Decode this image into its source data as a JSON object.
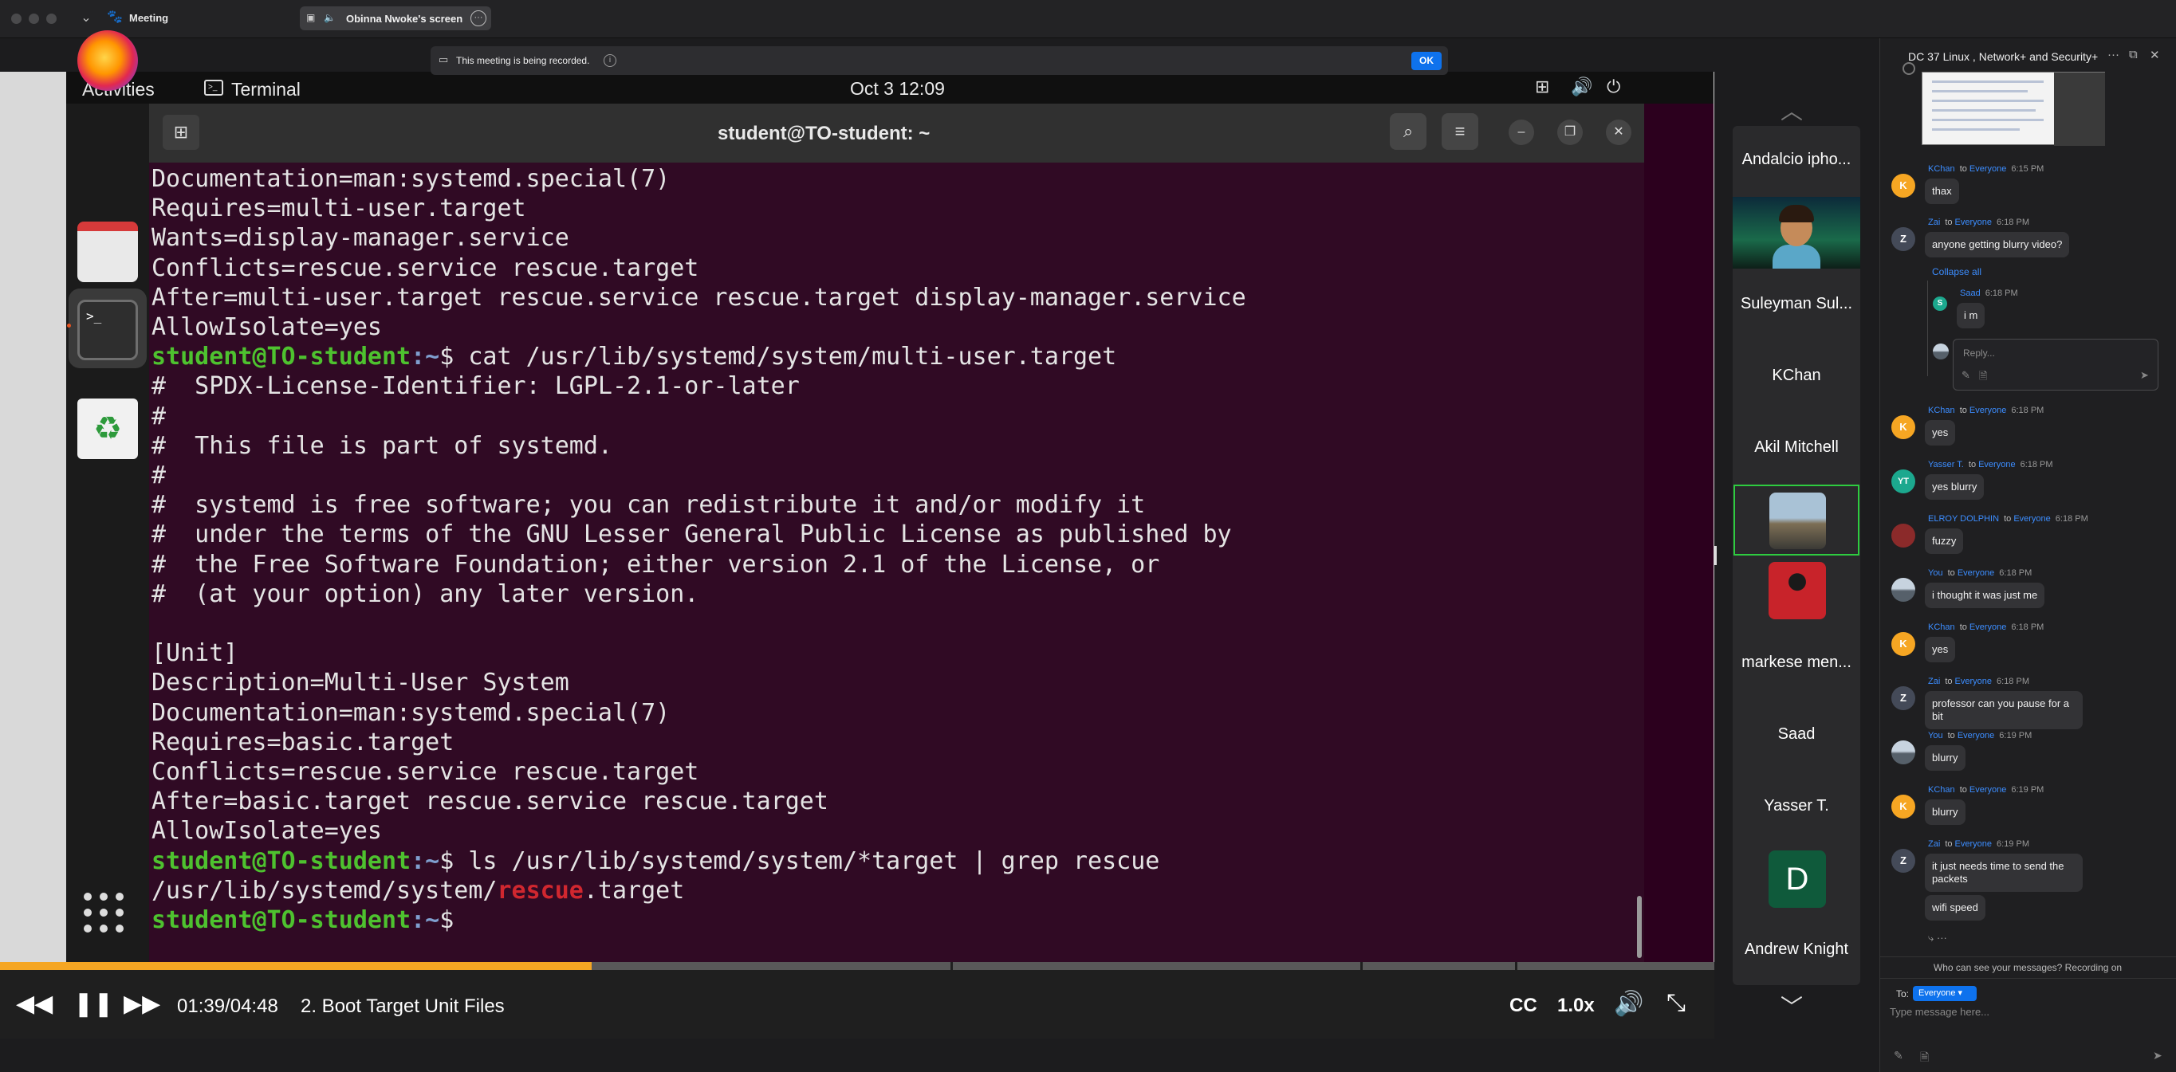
{
  "titlebar": {
    "app_name": "Meeting",
    "share_chip_label": "Obinna Nwoke's screen",
    "share_chip_more": "···"
  },
  "recording_banner": {
    "text": "This meeting is being recorded.",
    "info_icon": "i",
    "ok_label": "OK"
  },
  "gnome": {
    "activities": "Activities",
    "app_label": "Terminal",
    "clock": "Oct 3  12:09"
  },
  "terminal": {
    "title": "student@TO-student: ~",
    "lines": [
      {
        "text": "Documentation=man:systemd.special(7)"
      },
      {
        "text": "Requires=multi-user.target"
      },
      {
        "text": "Wants=display-manager.service"
      },
      {
        "text": "Conflicts=rescue.service rescue.target"
      },
      {
        "text": "After=multi-user.target rescue.service rescue.target display-manager.service"
      },
      {
        "text": "AllowIsolate=yes"
      },
      {
        "prompt_user": "student@TO-student",
        "prompt_path": ":~",
        "cmd": "$ cat /usr/lib/systemd/system/multi-user.target"
      },
      {
        "text": "#  SPDX-License-Identifier: LGPL-2.1-or-later"
      },
      {
        "text": "#"
      },
      {
        "text": "#  This file is part of systemd."
      },
      {
        "text": "#"
      },
      {
        "text": "#  systemd is free software; you can redistribute it and/or modify it"
      },
      {
        "text": "#  under the terms of the GNU Lesser General Public License as published by"
      },
      {
        "text": "#  the Free Software Foundation; either version 2.1 of the License, or"
      },
      {
        "text": "#  (at your option) any later version."
      },
      {
        "text": ""
      },
      {
        "text": "[Unit]"
      },
      {
        "text": "Description=Multi-User System"
      },
      {
        "text": "Documentation=man:systemd.special(7)"
      },
      {
        "text": "Requires=basic.target"
      },
      {
        "text": "Conflicts=rescue.service rescue.target"
      },
      {
        "text": "After=basic.target rescue.service rescue.target"
      },
      {
        "text": "AllowIsolate=yes"
      },
      {
        "prompt_user": "student@TO-student",
        "prompt_path": ":~",
        "cmd": "$ ls /usr/lib/systemd/system/*target | grep rescue"
      },
      {
        "pre": "/usr/lib/systemd/system/",
        "match": "rescue",
        "post": ".target"
      },
      {
        "prompt_user": "student@TO-student",
        "prompt_path": ":~",
        "cmd": "$ "
      }
    ]
  },
  "player": {
    "time": "01:39/04:48",
    "chapter": "2. Boot Target Unit Files",
    "cc": "CC",
    "speed": "1.0x",
    "progress": 0.345
  },
  "participants": [
    {
      "name": "Andalcio ipho..."
    },
    {
      "name": "Suleyman Sul..."
    },
    {
      "name": "KChan"
    },
    {
      "name": "Akil Mitchell"
    },
    {
      "name": "markese men..."
    },
    {
      "name": "Saad"
    },
    {
      "name": "Yasser T."
    },
    {
      "name": "Andrew Knight",
      "initial": "D"
    }
  ],
  "chat": {
    "title": "DC 37 Linux , Network+ and Security+",
    "to_word": "to",
    "collapse_all": "Collapse all",
    "reply_placeholder": "Reply...",
    "messages": [
      {
        "avatar": "K",
        "sender": "KChan",
        "to": "Everyone",
        "time": "6:15 PM",
        "text": "thax"
      },
      {
        "avatar": "Z",
        "sender": "Zai",
        "to": "Everyone",
        "time": "6:18 PM",
        "text": "anyone getting blurry video?"
      },
      {
        "avatar": "S",
        "sender": "Saad",
        "to": "",
        "time": "6:18 PM",
        "text": "i m"
      },
      {
        "avatar": "K",
        "sender": "KChan",
        "to": "Everyone",
        "time": "6:18 PM",
        "text": "yes"
      },
      {
        "avatar": "YT",
        "sender": "Yasser T.",
        "to": "Everyone",
        "time": "6:18 PM",
        "text": "yes blurry"
      },
      {
        "avatar": "",
        "sender": "ELROY DOLPHIN",
        "to": "Everyone",
        "time": "6:18 PM",
        "text": "fuzzy"
      },
      {
        "avatar": "",
        "sender": "You",
        "to": "Everyone",
        "time": "6:18 PM",
        "text": "i thought it was just me"
      },
      {
        "avatar": "K",
        "sender": "KChan",
        "to": "Everyone",
        "time": "6:18 PM",
        "text": "yes"
      },
      {
        "avatar": "Z",
        "sender": "Zai",
        "to": "Everyone",
        "time": "6:18 PM",
        "text": "professor can you pause for a bit"
      },
      {
        "avatar": "",
        "sender": "You",
        "to": "Everyone",
        "time": "6:19 PM",
        "text": "blurry"
      },
      {
        "avatar": "K",
        "sender": "KChan",
        "to": "Everyone",
        "time": "6:19 PM",
        "text": "blurry"
      },
      {
        "avatar": "Z",
        "sender": "Zai",
        "to": "Everyone",
        "time": "6:19 PM",
        "text": "it just needs time to send the packets",
        "text2": "wifi speed"
      }
    ],
    "who_can_see": "Who can see your messages? Recording on",
    "to_label": "To:",
    "to_value": "Everyone",
    "input_placeholder": "Type message here..."
  }
}
